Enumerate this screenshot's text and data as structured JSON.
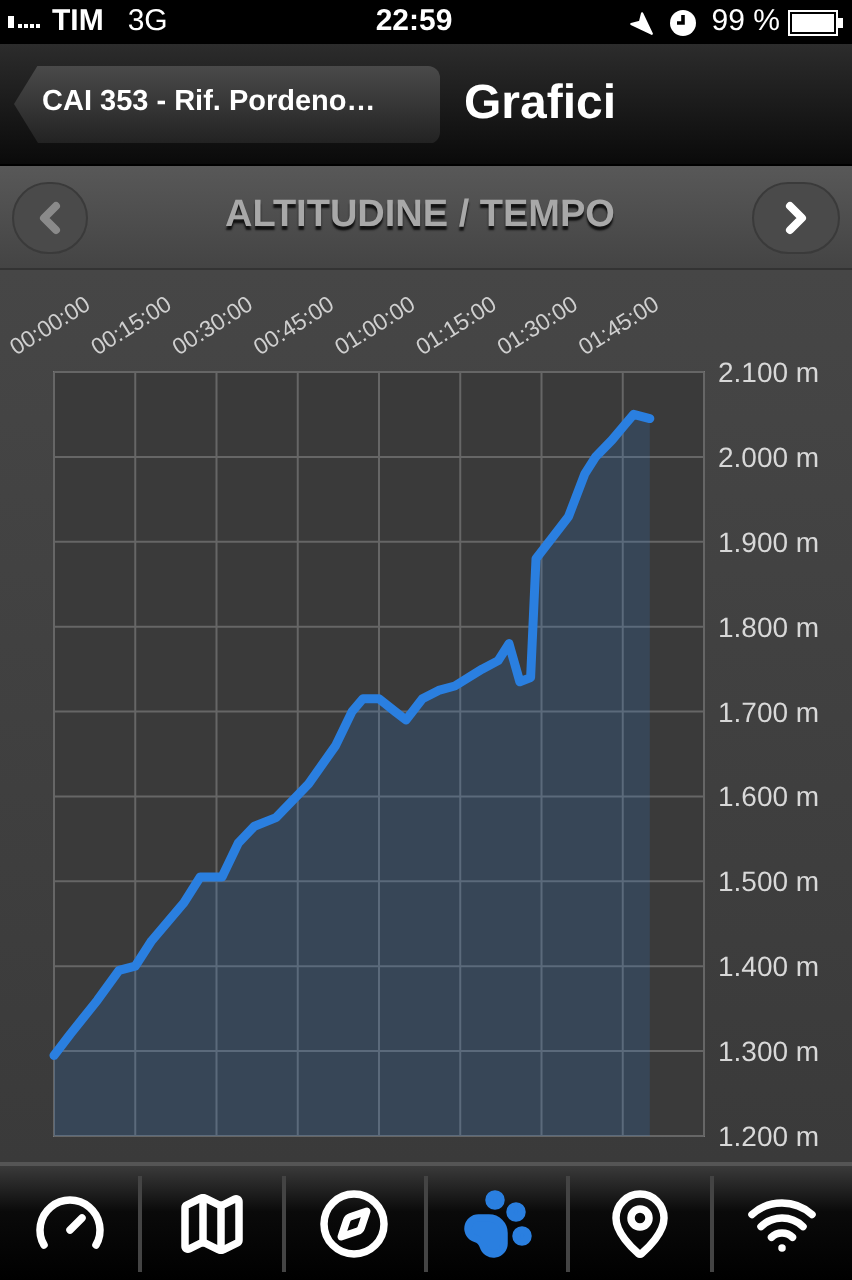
{
  "status_bar": {
    "carrier": "TIM",
    "network": "3G",
    "time": "22:59",
    "battery": "99 %"
  },
  "nav_bar": {
    "back_button": "CAI 353 - Rif. Pordeno…",
    "title": "Grafici"
  },
  "chart_header": {
    "title": "ALTITUDINE / TEMPO",
    "prev": {
      "disabled": true
    },
    "next": {
      "disabled": false
    }
  },
  "chart": {
    "chart_data": {
      "type": "area",
      "x": [
        0,
        3,
        8,
        12,
        15,
        18,
        24,
        27,
        31,
        34,
        37,
        41,
        47,
        52,
        55,
        57,
        60,
        63,
        65,
        68,
        71,
        74,
        79,
        82,
        84,
        86,
        88,
        89,
        92,
        95,
        98,
        100,
        103,
        105,
        107,
        110
      ],
      "series": [
        {
          "color": "#2a7fe0",
          "values": [
            1.295,
            1.32,
            1.36,
            1.395,
            1.4,
            1.43,
            1.475,
            1.505,
            1.505,
            1.545,
            1.565,
            1.575,
            1.615,
            1.66,
            1.7,
            1.715,
            1.715,
            1.7,
            1.69,
            1.715,
            1.725,
            1.73,
            1.75,
            1.76,
            1.78,
            1.735,
            1.74,
            1.88,
            1.905,
            1.93,
            1.98,
            2.0,
            2.02,
            2.035,
            2.05,
            2.045
          ]
        }
      ],
      "xlim": [
        0,
        120
      ],
      "ylim": [
        1.2,
        2.1
      ],
      "grid": true,
      "xticks": [
        {
          "value": 0,
          "label": "00:00:00"
        },
        {
          "value": 15,
          "label": "00:15:00"
        },
        {
          "value": 30,
          "label": "00:30:00"
        },
        {
          "value": 45,
          "label": "00:45:00"
        },
        {
          "value": 60,
          "label": "01:00:00"
        },
        {
          "value": 75,
          "label": "01:15:00"
        },
        {
          "value": 90,
          "label": "01:30:00"
        },
        {
          "value": 105,
          "label": "01:45:00"
        }
      ],
      "yticks": [
        {
          "value": 1.2,
          "label": "1.200 m"
        },
        {
          "value": 1.3,
          "label": "1.300 m"
        },
        {
          "value": 1.4,
          "label": "1.400 m"
        },
        {
          "value": 1.5,
          "label": "1.500 m"
        },
        {
          "value": 1.6,
          "label": "1.600 m"
        },
        {
          "value": 1.7,
          "label": "1.700 m"
        },
        {
          "value": 1.8,
          "label": "1.800 m"
        },
        {
          "value": 1.9,
          "label": "1.900 m"
        },
        {
          "value": 2.0,
          "label": "2.000 m"
        },
        {
          "value": 2.1,
          "label": "2.100 m"
        }
      ]
    }
  },
  "tab_bar": {
    "tabs": [
      {
        "selected": false
      },
      {
        "selected": false
      },
      {
        "selected": false
      },
      {
        "selected": true
      },
      {
        "selected": false
      },
      {
        "selected": false
      }
    ]
  }
}
